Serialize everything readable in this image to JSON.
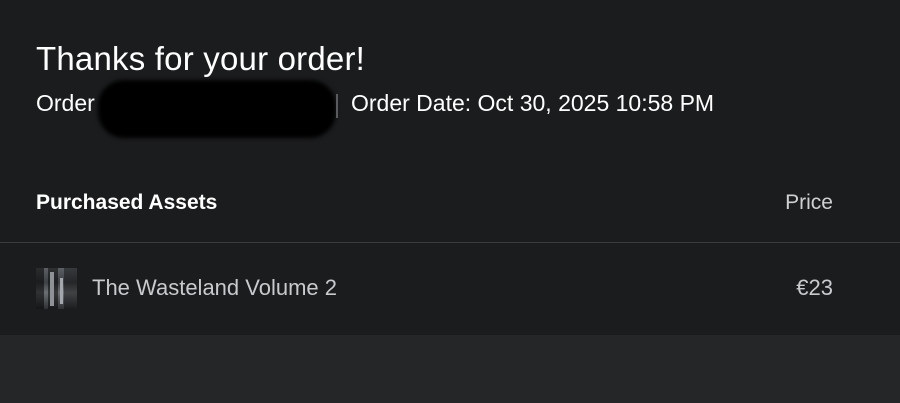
{
  "header": {
    "title": "Thanks for your order!",
    "order_label": "Order",
    "order_date": "Order Date: Oct 30, 2025 10:58 PM"
  },
  "table": {
    "columns": {
      "assets": "Purchased Assets",
      "price": "Price"
    },
    "rows": [
      {
        "thumbnail_icon": "asset-thumbnail",
        "name": "The Wasteland Volume 2",
        "price": "€23"
      }
    ]
  },
  "colors": {
    "card_background": "#1b1c1e",
    "page_background": "#252628",
    "text_primary": "#ffffff",
    "text_secondary": "#c9cacd"
  }
}
